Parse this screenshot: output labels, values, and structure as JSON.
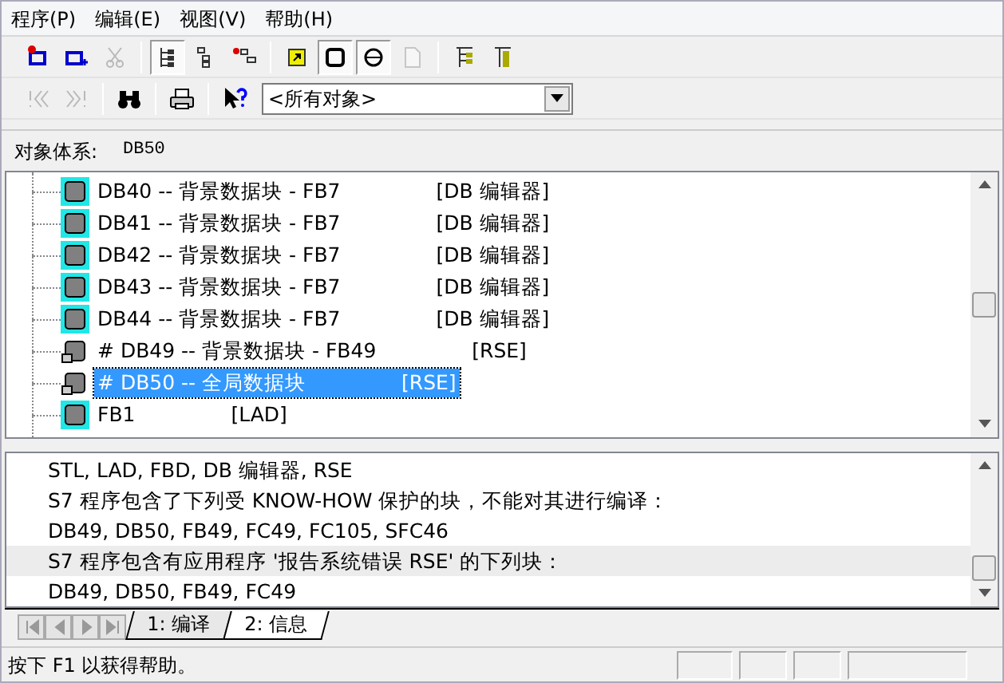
{
  "menu": [
    {
      "label": "程序(P)"
    },
    {
      "label": "编辑(E)"
    },
    {
      "label": "视图(V)"
    },
    {
      "label": "帮助(H)"
    }
  ],
  "toolbar_1": [
    {
      "kind": "block-minus",
      "disabled": false,
      "pressed": false
    },
    {
      "kind": "block-plus",
      "disabled": false,
      "pressed": false
    },
    {
      "kind": "scissors",
      "disabled": true,
      "pressed": false
    },
    {
      "kind": "sep"
    },
    {
      "kind": "tree",
      "disabled": false,
      "pressed": true
    },
    {
      "kind": "tree2",
      "disabled": false,
      "pressed": false
    },
    {
      "kind": "link",
      "disabled": false,
      "pressed": false
    },
    {
      "kind": "sep"
    },
    {
      "kind": "jump",
      "disabled": false,
      "pressed": false
    },
    {
      "kind": "square",
      "disabled": false,
      "pressed": true
    },
    {
      "kind": "circle",
      "disabled": false,
      "pressed": true
    },
    {
      "kind": "page",
      "disabled": true,
      "pressed": false
    },
    {
      "kind": "sep"
    },
    {
      "kind": "tree3",
      "disabled": false,
      "pressed": false
    },
    {
      "kind": "tree4",
      "disabled": false,
      "pressed": false
    }
  ],
  "toolbar_2": [
    {
      "kind": "first",
      "disabled": true
    },
    {
      "kind": "last",
      "disabled": true
    },
    {
      "kind": "sep"
    },
    {
      "kind": "binoculars",
      "disabled": false
    },
    {
      "kind": "sep"
    },
    {
      "kind": "printer",
      "disabled": false
    },
    {
      "kind": "sep"
    },
    {
      "kind": "help",
      "disabled": false
    }
  ],
  "filter": {
    "value": "<所有对象>"
  },
  "object_path": {
    "label": "对象体系:",
    "value": "DB50"
  },
  "tree": [
    {
      "kind": "block",
      "name": "DB40 -- 背景数据块 - FB7",
      "tag": "[DB 编辑器]",
      "selected": false
    },
    {
      "kind": "block",
      "name": "DB41 -- 背景数据块 - FB7",
      "tag": "[DB 编辑器]",
      "selected": false
    },
    {
      "kind": "block",
      "name": "DB42 -- 背景数据块 - FB7",
      "tag": "[DB 编辑器]",
      "selected": false
    },
    {
      "kind": "block",
      "name": "DB43 -- 背景数据块 - FB7",
      "tag": "[DB 编辑器]",
      "selected": false
    },
    {
      "kind": "block",
      "name": "DB44 -- 背景数据块 - FB7",
      "tag": "[DB 编辑器]",
      "selected": false
    },
    {
      "kind": "protected",
      "name": "# DB49 -- 背景数据块 - FB49",
      "tag": "[RSE]",
      "selected": false
    },
    {
      "kind": "protected",
      "name": "# DB50 -- 全局数据块",
      "tag": "[RSE]",
      "selected": true
    },
    {
      "kind": "block",
      "name": "FB1",
      "tag": "[LAD]",
      "selected": false
    }
  ],
  "messages": [
    {
      "text": "STL, LAD, FBD, DB 编辑器, RSE",
      "selected": false
    },
    {
      "text": "S7 程序包含了下列受 KNOW-HOW 保护的块，不能对其进行编译：",
      "selected": false
    },
    {
      "text": "DB49, DB50, FB49, FC49, FC105, SFC46",
      "selected": false
    },
    {
      "text": "S7 程序包含有应用程序 '报告系统错误 RSE' 的下列块：",
      "selected": true
    },
    {
      "text": "DB49, DB50, FB49, FC49",
      "selected": false
    }
  ],
  "tabs": [
    {
      "label": "1: 编译",
      "selected": false
    },
    {
      "label": "2: 信息",
      "selected": true
    }
  ],
  "status_bar": {
    "text": "按下 F1 以获得帮助。"
  }
}
